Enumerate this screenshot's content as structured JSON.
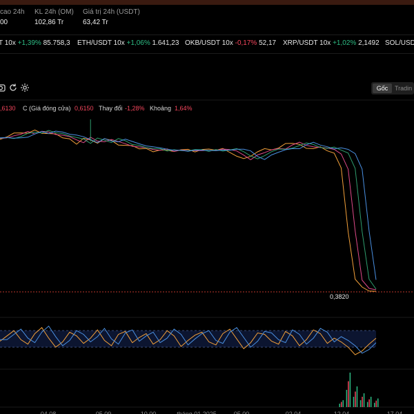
{
  "stats": [
    {
      "label": "cao 24h",
      "value": "00"
    },
    {
      "label": "KL 24h (OM)",
      "value": "102,86 Tr"
    },
    {
      "label": "Giá trị 24h (USDT)",
      "value": "63,42 Tr"
    }
  ],
  "ticker": [
    {
      "pair": "T 10x",
      "change": "+1,39%",
      "dir": "up",
      "price": "85.758,3"
    },
    {
      "pair": "ETH/USDT 10x",
      "change": "+1,06%",
      "dir": "up",
      "price": "1.641,23"
    },
    {
      "pair": "OKB/USDT 10x",
      "change": "-0,17%",
      "dir": "dn",
      "price": "52,17"
    },
    {
      "pair": "XRP/USDT 10x",
      "change": "+1,02%",
      "dir": "up",
      "price": "2,1492"
    },
    {
      "pair": "SOL/USDT",
      "change": "",
      "dir": "up",
      "price": ""
    }
  ],
  "toolbar": {
    "view_original": "Gốc",
    "view_tradingview": "Tradin"
  },
  "ohlc": {
    "open_tail": ",6130",
    "close_label": "C (Giá đóng cửa)",
    "close_value": "0,6150",
    "change_label": "Thay đổi",
    "change_value": "-1,28%",
    "range_label": "Khoảng",
    "range_value": "1,64%"
  },
  "chart_data": {
    "type": "line",
    "price_line_value": 0.382,
    "price_label": "0,3820",
    "title": "",
    "xlabel": "",
    "ylabel": "",
    "series": [
      {
        "values": [
          0.605,
          0.607,
          0.611,
          0.614,
          0.612,
          0.615,
          0.613,
          0.611,
          0.609,
          0.606,
          0.603,
          0.598,
          0.605,
          0.601,
          0.599,
          0.604,
          0.6,
          0.596,
          0.594,
          0.592,
          0.59,
          0.589,
          0.587,
          0.588,
          0.586,
          0.587,
          0.588,
          0.587,
          0.586,
          0.588,
          0.587,
          0.588,
          0.589,
          0.586,
          0.579,
          0.574,
          0.58,
          0.585,
          0.588,
          0.589,
          0.59,
          0.595,
          0.598,
          0.595,
          0.592,
          0.59,
          0.591,
          0.588,
          0.583,
          0.56,
          0.47,
          0.4,
          0.387,
          0.384,
          0.382
        ]
      }
    ],
    "oscillator": [
      48,
      55,
      62,
      50,
      44,
      58,
      66,
      52,
      40,
      47,
      60,
      55,
      45,
      52,
      63,
      49,
      42,
      57,
      61,
      46,
      53,
      58,
      44,
      50,
      62,
      55,
      41,
      49,
      56,
      60,
      47,
      43,
      58,
      64,
      51,
      38,
      46,
      59,
      57,
      48,
      44,
      61,
      55,
      42,
      50,
      63,
      58,
      45,
      52,
      47,
      40,
      30,
      35,
      44,
      52
    ],
    "volume": [
      0,
      0,
      0,
      0,
      0,
      0,
      0,
      0,
      0,
      0,
      0,
      0,
      0,
      0,
      0,
      0,
      0,
      0,
      0,
      0,
      0,
      0,
      0,
      0,
      0,
      0,
      0,
      0,
      0,
      0,
      0,
      0,
      0,
      0,
      0,
      0,
      0,
      0,
      0,
      0,
      0,
      0,
      0,
      0,
      0,
      0,
      0,
      0,
      0,
      0.2,
      1.0,
      0.6,
      0.4,
      0.3,
      0.25
    ],
    "x_ticks": [
      "04 08",
      "05 09",
      "10 00",
      "tháng 01 2025",
      "05 00",
      "02 04",
      "12 04",
      "17 04"
    ]
  }
}
